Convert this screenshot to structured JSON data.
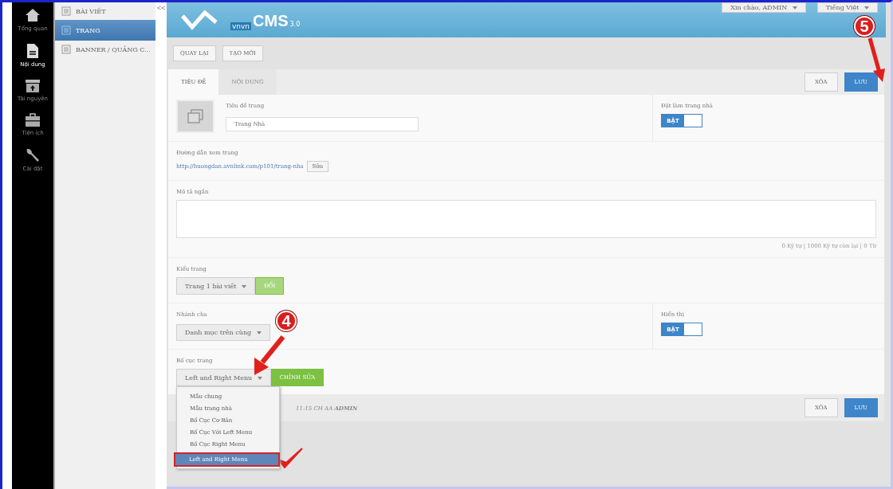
{
  "nav_rail": [
    {
      "label": "Tổng quan",
      "selected": false
    },
    {
      "label": "Nội dung",
      "selected": true
    },
    {
      "label": "Tài nguyên",
      "selected": false
    },
    {
      "label": "Tiện ích",
      "selected": false
    },
    {
      "label": "Cài đặt",
      "selected": false
    }
  ],
  "sidebar": {
    "collapse": "<<",
    "items": [
      {
        "label": "BÀI VIẾT",
        "selected": false
      },
      {
        "label": "TRANG",
        "selected": true
      },
      {
        "label": "BANNER / QUẢNG C...",
        "selected": false
      }
    ]
  },
  "header": {
    "logo_mark": "vnvn",
    "logo_text": "CMS",
    "logo_version": "3.0",
    "user_menu": "Xin chào, ADMIN",
    "language_menu": "Tiếng Việt"
  },
  "toolbar": [
    "QUAY LẠI",
    "TẠO MỚI"
  ],
  "tabs": [
    {
      "label": "TIÊU ĐỀ",
      "selected": true
    },
    {
      "label": "NỘI DUNG",
      "selected": false
    }
  ],
  "actions": {
    "delete": "XÓA",
    "save": "LƯU"
  },
  "form": {
    "title_label": "Tiêu đề trang",
    "title_value": "Trang Nhà",
    "homepage_label": "Đặt làm trang nhà",
    "homepage_toggle": {
      "label": "BẬT",
      "on": true
    },
    "url_label": "Đường dẫn xem trang",
    "url": "http://huongdan.avnlink.com/p101/trang-nha",
    "url_edit": "Sửa",
    "summary_label": "Mô tả ngắn",
    "summary_counter": "0 Ký tự | 1000 Ký tự còn lại | 0 Từ",
    "page_type_label": "Kiểu trang",
    "page_type_value": "Trang 1 bài viết",
    "page_type_button": "ĐỔI",
    "parent_label": "Nhánh cha",
    "parent_value": "Danh mục trên cùng",
    "visible_label": "Hiển thị",
    "visible_toggle": {
      "label": "BẬT",
      "on": true
    },
    "layout_label": "Bố cục trang",
    "layout_value": "Left and Right Menu",
    "layout_button": "CHỈNH SỬA",
    "layout_options": [
      {
        "label": "Mẫu chung",
        "selected": false
      },
      {
        "label": "Mẫu trang nhà",
        "selected": false
      },
      {
        "label": "Bố Cục Cơ Bản",
        "selected": false
      },
      {
        "label": "Bố Cục Với Left Menu",
        "selected": false
      },
      {
        "label": "Bố Cục Right Menu",
        "selected": false
      },
      {
        "label": "Left and Right Menu",
        "selected": true
      }
    ]
  },
  "footer": {
    "info": "11:15 CH AA **ADMIN**",
    "delete": "XÓA",
    "save": "LƯU"
  },
  "annotations": [
    {
      "number": "4"
    },
    {
      "number": "5"
    }
  ]
}
